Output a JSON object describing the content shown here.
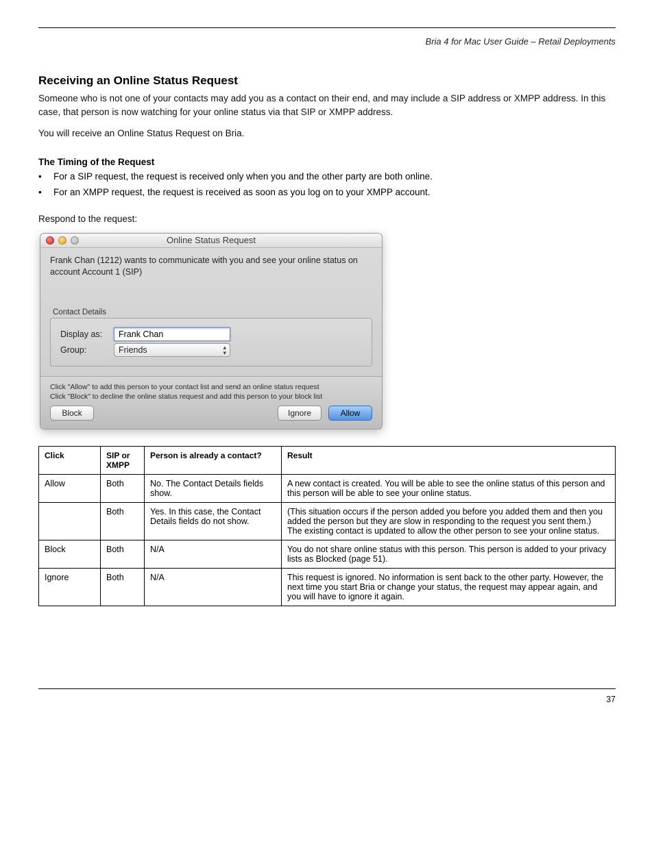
{
  "header": {
    "right": "Bria 4 for Mac User Guide – Retail Deployments"
  },
  "section": {
    "title": "Receiving an Online Status Request",
    "p1": "Someone who is not one of your contacts may add you as a contact on their end, and may include a SIP address or XMPP address. In this case, that person is now watching for your online status via that SIP or XMPP address.",
    "p2": "You will receive an Online Status Request on Bria."
  },
  "timing": {
    "title": "The Timing of the Request",
    "items": [
      "For a SIP request, the request is received only when you and the other party are both online.",
      "For an XMPP request, the request is received as soon as you log on to your XMPP account."
    ]
  },
  "dialog_intro": "Respond to the request:",
  "dialog": {
    "title": "Online Status Request",
    "message": "Frank Chan (1212) wants to communicate with you and see your online status on account  Account 1 (SIP)",
    "contact_details_label": "Contact Details",
    "display_as_label": "Display as:",
    "display_as_value": "Frank Chan",
    "group_label": "Group:",
    "group_value": "Friends",
    "help1": "Click \"Allow\" to add this person to your contact list and send an online status request",
    "help2": "Click \"Block\" to decline the online status request and add this person to your block list",
    "block_label": "Block",
    "ignore_label": "Ignore",
    "allow_label": "Allow"
  },
  "table": {
    "headers": [
      "Click",
      "SIP or XMPP",
      "Person is already a contact?",
      "Result"
    ],
    "rows": [
      {
        "click": "Allow",
        "proto": "Both",
        "contact": "No. The Contact Details fields show.",
        "result": "A new contact is created. You will be able to see the online status of this person and this person will be able to see your online status."
      },
      {
        "click": "",
        "proto": "Both",
        "contact": "Yes. In this case, the Contact Details fields do not show.",
        "result": "(This situation occurs if the person added you before you added them and then you added the person but they are slow in responding to the request you sent them.)\nThe existing contact is updated to allow the other person to see your online status."
      },
      {
        "click": "Block",
        "proto": "Both",
        "contact": "N/A",
        "result": "You do not share online status with this person. This person is added to your privacy lists as Blocked (page 51)."
      },
      {
        "click": "Ignore",
        "proto": "Both",
        "contact": "N/A",
        "result": "This request is ignored. No information is sent back to the other party. However, the next time you start Bria or change your status, the request may appear again, and you will have to ignore it again."
      }
    ]
  },
  "footer": {
    "page": "37"
  }
}
